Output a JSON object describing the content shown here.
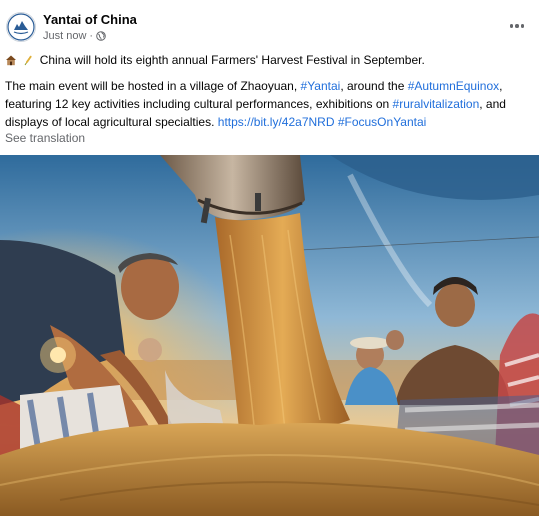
{
  "post": {
    "page_name": "Yantai of China",
    "timestamp": "Just now",
    "separator": "·",
    "privacy_icon": "globe-icon",
    "more_icon": "more-options-icon",
    "line1_text": "China will hold its eighth annual Farmers' Harvest Festival in September.",
    "line2_text": "The main event will be hosted in a village of Zhaoyuan, ",
    "line2_hashtag_yantai": "#Yantai",
    "line2_mid": ", around the ",
    "line2_hashtag_equinox": "#AutumnEquinox",
    "line2_end": ",",
    "line3_text": "featuring 12 key activities including cultural performances, exhibitions on ",
    "line3_hashtag": "#ruralvitalization",
    "line3_end": ", and",
    "line4_text": "displays of local agricultural specialties. ",
    "line4_link": "https://bit.ly/42a7NRD",
    "line4_hashtag": "#FocusOnYantai",
    "see_translation": "See translation",
    "emojis": [
      "house-emoji",
      "wheat-emoji"
    ]
  },
  "photo": {
    "subject": "harvest-grain-photo"
  },
  "colors": {
    "link": "#216fdb",
    "secondary_text": "#65676b",
    "grain": "#c08a3c",
    "sky": "#5b8fb8"
  }
}
